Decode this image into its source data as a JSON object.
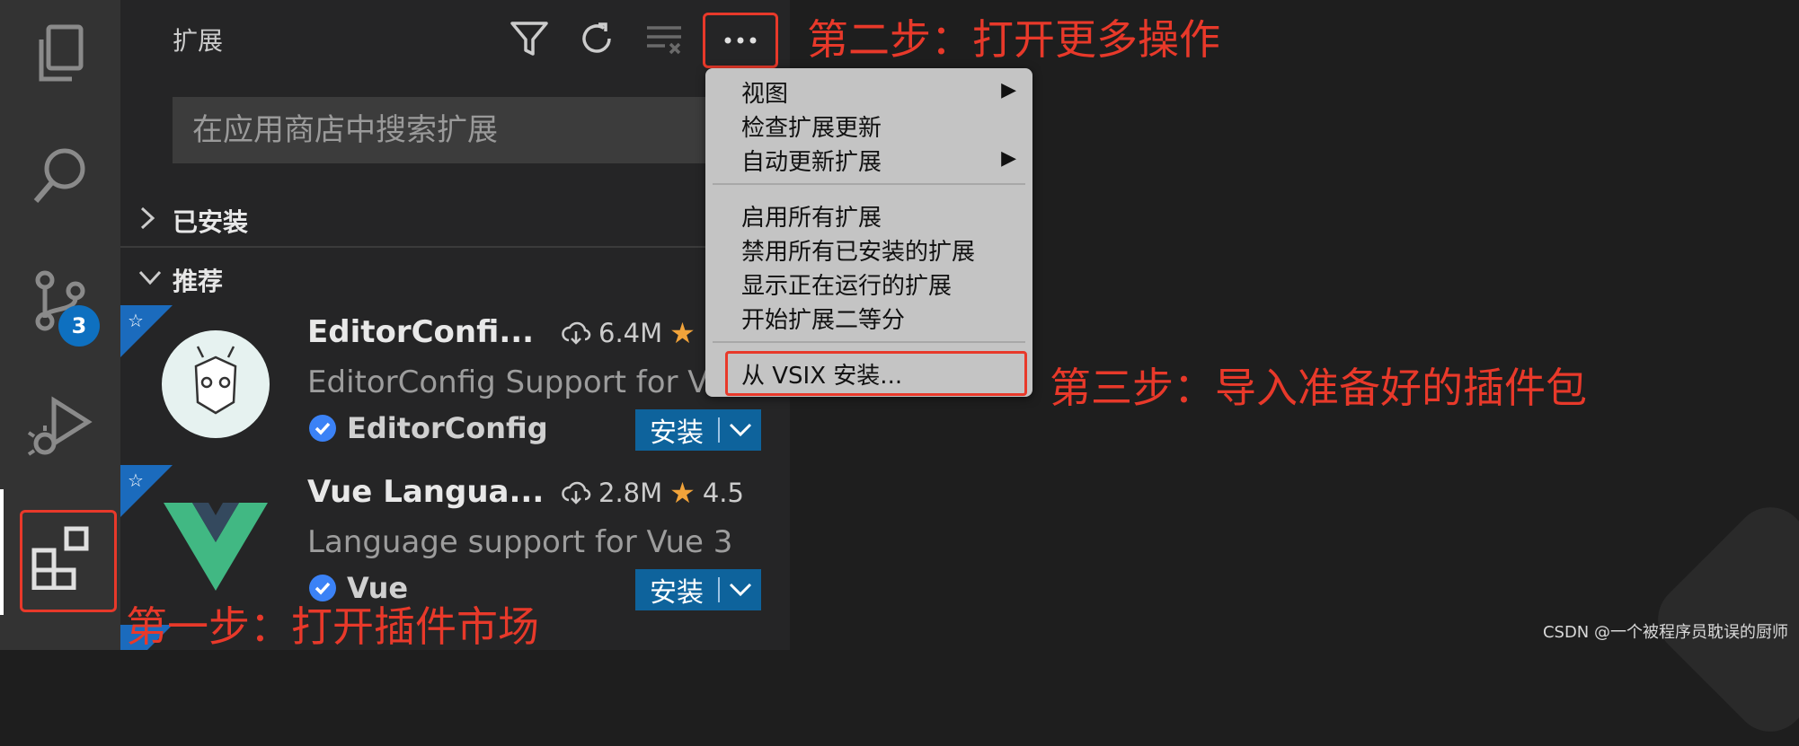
{
  "sidebar": {
    "title": "扩展",
    "search_placeholder": "在应用商店中搜索扩展",
    "sections": {
      "installed": "已安装",
      "recommended": "推荐"
    }
  },
  "activity_bar": {
    "scm_badge": "3"
  },
  "extensions": [
    {
      "name": "EditorConfi...",
      "downloads": "6.4M",
      "rating": "",
      "description": "EditorConfig Support for Vi...",
      "publisher": "EditorConfig",
      "install_label": "安装"
    },
    {
      "name": "Vue Langua...",
      "downloads": "2.8M",
      "rating": "4.5",
      "description": "Language support for Vue 3",
      "publisher": "Vue",
      "install_label": "安装"
    }
  ],
  "menu": {
    "items": [
      {
        "label": "视图",
        "submenu": true
      },
      {
        "label": "检查扩展更新",
        "submenu": false
      },
      {
        "label": "自动更新扩展",
        "submenu": true
      },
      {
        "label": "启用所有扩展",
        "submenu": false
      },
      {
        "label": "禁用所有已安装的扩展",
        "submenu": false
      },
      {
        "label": "显示正在运行的扩展",
        "submenu": false
      },
      {
        "label": "开始扩展二等分",
        "submenu": false
      },
      {
        "label": "从 VSIX 安装...",
        "submenu": false
      }
    ],
    "submenu_arrow": "▶"
  },
  "annotations": {
    "step1": "第一步：打开插件市场",
    "step2": "第二步：打开更多操作",
    "step3": "第三步：导入准备好的插件包"
  },
  "watermark": "CSDN @一个被程序员耽误的厨师",
  "colors": {
    "accent": "#e8392a",
    "install": "#0e639c",
    "badge": "#0e70c0",
    "star": "#f1a33a"
  }
}
